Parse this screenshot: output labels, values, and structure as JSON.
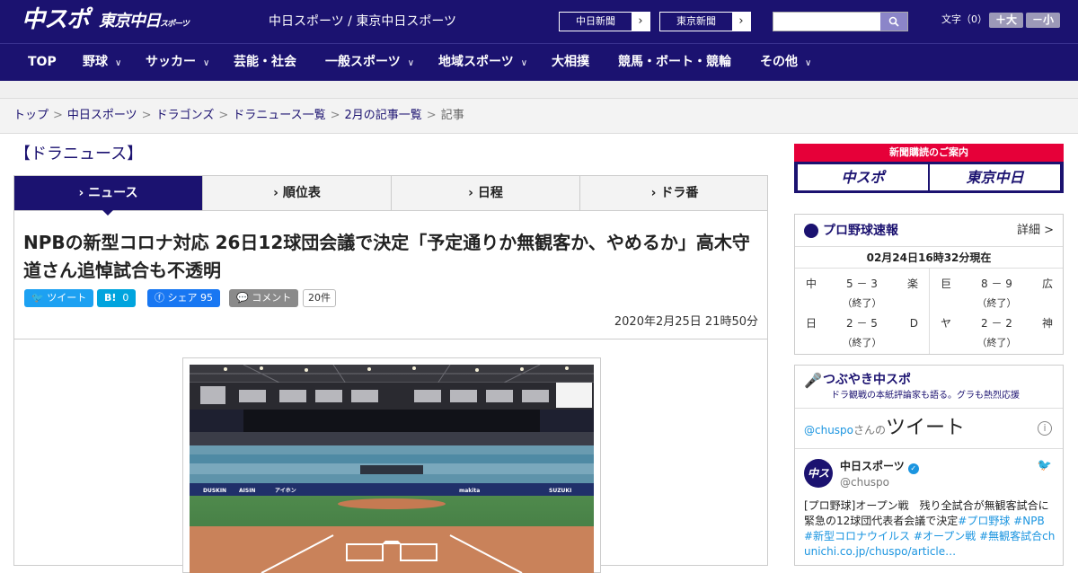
{
  "header": {
    "logo_main": "中スポ",
    "logo_tokyo": "東京中日",
    "logo_tokyo_small": "スポーツ",
    "site_names": "中日スポーツ / 東京中日スポーツ",
    "ext_links": [
      {
        "label": "中日新聞",
        "arrow": "›"
      },
      {
        "label": "東京新聞",
        "arrow": "›"
      }
    ],
    "search_placeholder": "",
    "search_icon": "magnifier-icon",
    "fontsize_label": "文字（0）",
    "fontsize_up": "＋大",
    "fontsize_down": "－小"
  },
  "nav": {
    "items": [
      {
        "label": "TOP",
        "chevron": ""
      },
      {
        "label": "野球",
        "chevron": "∨"
      },
      {
        "label": "サッカー",
        "chevron": "∨"
      },
      {
        "label": "芸能・社会",
        "chevron": ""
      },
      {
        "label": "一般スポーツ",
        "chevron": "∨"
      },
      {
        "label": "地域スポーツ",
        "chevron": "∨"
      },
      {
        "label": "大相撲",
        "chevron": ""
      },
      {
        "label": "競馬・ボート・競輪",
        "chevron": ""
      },
      {
        "label": "その他",
        "chevron": "∨"
      }
    ]
  },
  "breadcrumb": {
    "items": [
      "トップ",
      "中日スポーツ",
      "ドラゴンズ",
      "ドラニュース一覧",
      "2月の記事一覧"
    ],
    "current": "記事",
    "separator": ">"
  },
  "section": {
    "heading": "【ドラニュース】"
  },
  "tabs": [
    {
      "label": "› ニュース",
      "active": true
    },
    {
      "label": "› 順位表",
      "active": false
    },
    {
      "label": "› 日程",
      "active": false
    },
    {
      "label": "› ドラ番",
      "active": false
    }
  ],
  "article": {
    "title": "NPBの新型コロナ対応 26日12球団会議で決定「予定通りか無観客か、やめるか」高木守道さん追悼試合も不透明",
    "share": {
      "tweet": "ツイート",
      "hatena_mark": "B!",
      "hatena_count": "0",
      "facebook": "シェア",
      "facebook_count": "95",
      "comment": "コメント",
      "comment_count": "20件"
    },
    "published": "2020年2月25日 21時50分",
    "photo_desc": "stadium-photo"
  },
  "sidebar": {
    "subscribe": {
      "title": "新聞購読のご案内",
      "logo_left": "中スポ",
      "logo_right": "東京中日"
    },
    "scores": {
      "title": "プロ野球速報",
      "more": "詳細 >",
      "time": "02月24日16時32分現在",
      "games": [
        {
          "team1": "中",
          "score": "5 － 3",
          "team2": "楽",
          "status": "（終了）"
        },
        {
          "team1": "巨",
          "score": "8 － 9",
          "team2": "広",
          "status": "（終了）"
        },
        {
          "team1": "日",
          "score": "2 － 5",
          "team2": "D",
          "status": "（終了）"
        },
        {
          "team1": "ヤ",
          "score": "2 － 2",
          "team2": "神",
          "status": "（終了）"
        }
      ]
    },
    "tweets": {
      "title": "つぶやき中スポ",
      "subtitle": "ドラ観戦の本紙評論家も語る。グラも熱烈応援",
      "handle": "@chuspo",
      "handle_suffix": "さんの",
      "big_label": "ツイート",
      "info": "i",
      "user_name": "中日スポーツ",
      "verified": "✓",
      "screen_name": "@chuspo",
      "avatar_text": "中スポ",
      "text_parts": [
        {
          "t": "[プロ野球]オープン戦　残り全試合が無観客試合に　緊急の12球団代表者会議で決定",
          "tag": false
        },
        {
          "t": "#プロ野球",
          "tag": true
        },
        {
          "t": " ",
          "tag": false
        },
        {
          "t": "#NPB",
          "tag": true
        },
        {
          "t": " ",
          "tag": false
        },
        {
          "t": "#新型コロナウイルス",
          "tag": true
        },
        {
          "t": " ",
          "tag": false
        },
        {
          "t": "#オープン戦",
          "tag": true
        },
        {
          "t": " ",
          "tag": false
        },
        {
          "t": "#無観客試合",
          "tag": true
        },
        {
          "t": "chunichi.co.jp/chuspo/article…",
          "tag": true
        }
      ]
    }
  }
}
